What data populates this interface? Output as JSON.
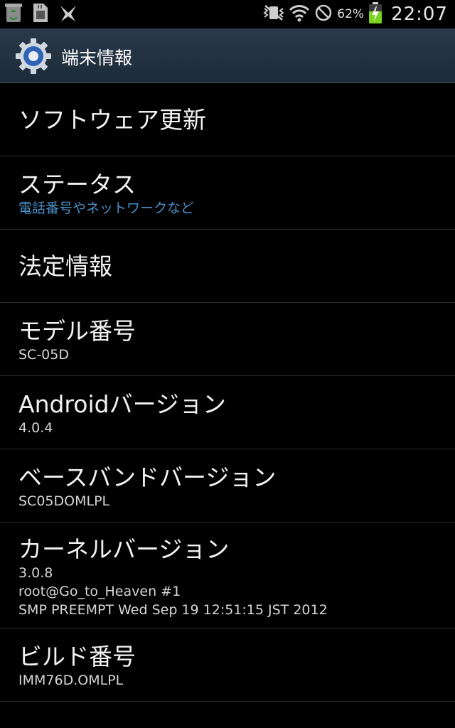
{
  "status_bar": {
    "battery_percent": "62%",
    "time": "22:07",
    "icons_left": [
      "recycle-icon",
      "sd-card-icon",
      "usb-debug-icon"
    ],
    "icons_right": [
      "mute-vibrate-icon",
      "wifi-icon",
      "no-signal-icon",
      "battery-charging-icon"
    ],
    "battery_color": "#7bd321"
  },
  "action_bar": {
    "title": "端末情報",
    "icon": "settings-gear-icon"
  },
  "items": [
    {
      "title": "ソフトウェア更新",
      "sub": ""
    },
    {
      "title": "ステータス",
      "sub": "電話番号やネットワークなど"
    },
    {
      "title": "法定情報",
      "sub": ""
    },
    {
      "title": "モデル番号",
      "sub": "SC-05D"
    },
    {
      "title": "Androidバージョン",
      "sub": "4.0.4"
    },
    {
      "title": "ベースバンドバージョン",
      "sub": "SC05DOMLPL"
    },
    {
      "title": "カーネルバージョン",
      "sub": "3.0.8",
      "sub2": "root@Go_to_Heaven #1",
      "sub3": "SMP PREEMPT Wed Sep 19 12:51:15 JST 2012"
    },
    {
      "title": "ビルド番号",
      "sub": "IMM76D.OMLPL"
    }
  ],
  "colors": {
    "link_blue": "#4a90c9",
    "actionbar_top": "#2a3a4b",
    "divider": "#2b2b2b"
  }
}
